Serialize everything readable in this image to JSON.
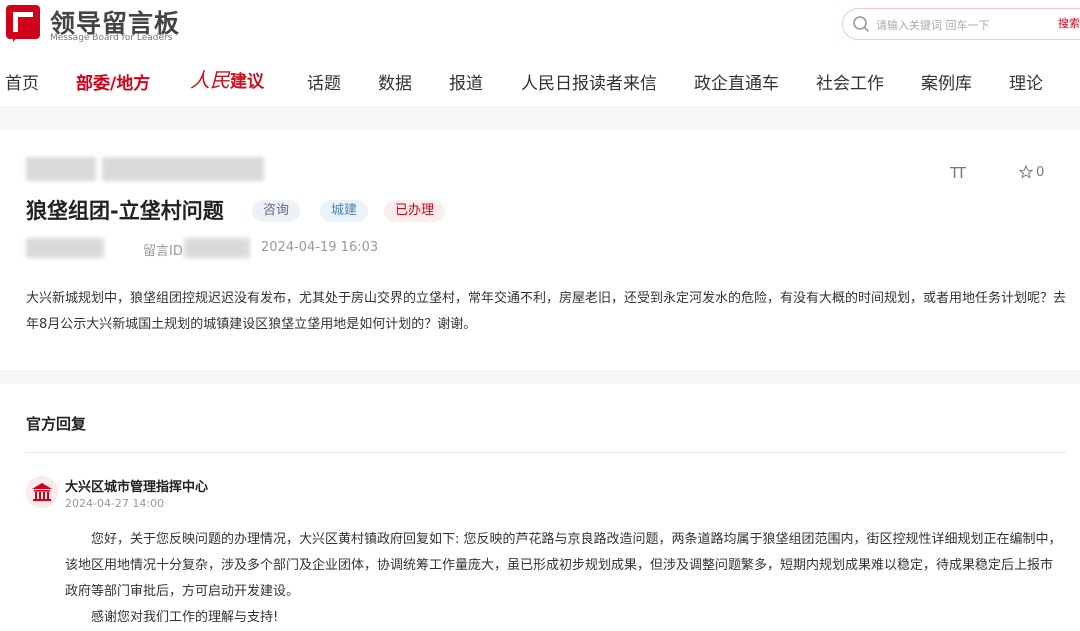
{
  "brand": {
    "title": "领导留言板",
    "subtitle": "Message Board for Leaders",
    "color": "#d0021b"
  },
  "search": {
    "placeholder": "请输入关键词 回车一下",
    "button_label": "搜索"
  },
  "nav": {
    "items": [
      "首页",
      "部委/地方",
      "人民建议",
      "话题",
      "数据",
      "报道",
      "人民日报读者来信",
      "政企直通车",
      "社会工作",
      "案例库",
      "理论"
    ],
    "active_index": 1,
    "special_prefix": "人民",
    "special_suffix": "建议"
  },
  "message": {
    "title": "狼垡组团-立垡村问题",
    "tags": [
      "咨询",
      "城建",
      "已办理"
    ],
    "id_label": "留言ID",
    "date": "2024-04-19 16:03",
    "favorites": "0",
    "font_toggle": "TT",
    "body": "大兴新城规划中，狼垡组团控规迟迟没有发布，尤其处于房山交界的立垡村，常年交通不利，房屋老旧，还受到永定河发水的危险，有没有大概的时间规划，或者用地任务计划呢？去年8月公示大兴新城国土规划的城镇建设区狼垡立垡用地是如何计划的？谢谢。"
  },
  "reply": {
    "heading": "官方回复",
    "org_name": "大兴区城市管理指挥中心",
    "time": "2024-04-27 14:00",
    "paragraphs": [
      "您好，关于您反映问题的办理情况，大兴区黄村镇政府回复如下: 您反映的芦花路与京良路改造问题，两条道路均属于狼垡组团范围内，街区控规性详细规划正在编制中，该地区用地情况十分复杂，涉及多个部门及企业团体，协调统筹工作量庞大，虽已形成初步规划成果，但涉及调整问题繁多，短期内规划成果难以稳定，待成果稳定后上报市政府等部门审批后，方可启动开发建设。",
      "感谢您对我们工作的理解与支持!"
    ]
  }
}
